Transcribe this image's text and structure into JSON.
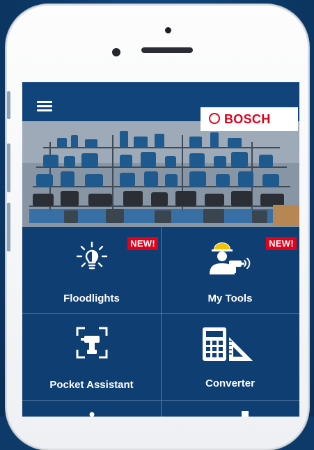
{
  "brand": {
    "name": "BOSCH",
    "color": "#e2001a"
  },
  "colors": {
    "screen": "#0e3e72",
    "appbar": "#11447b",
    "badge": "#e2001a"
  },
  "menu": {
    "icon": "hamburger-menu-icon"
  },
  "hero": {
    "icon": "power-tools-collection-image"
  },
  "tiles": [
    {
      "label": "Floodlights",
      "badge": "NEW!",
      "icon": "floodlight-icon"
    },
    {
      "label": "My Tools",
      "badge": "NEW!",
      "icon": "worker-drill-icon"
    },
    {
      "label": "Pocket Assistant",
      "icon": "drill-scan-icon"
    },
    {
      "label": "Converter",
      "icon": "calculator-ruler-icon"
    }
  ]
}
